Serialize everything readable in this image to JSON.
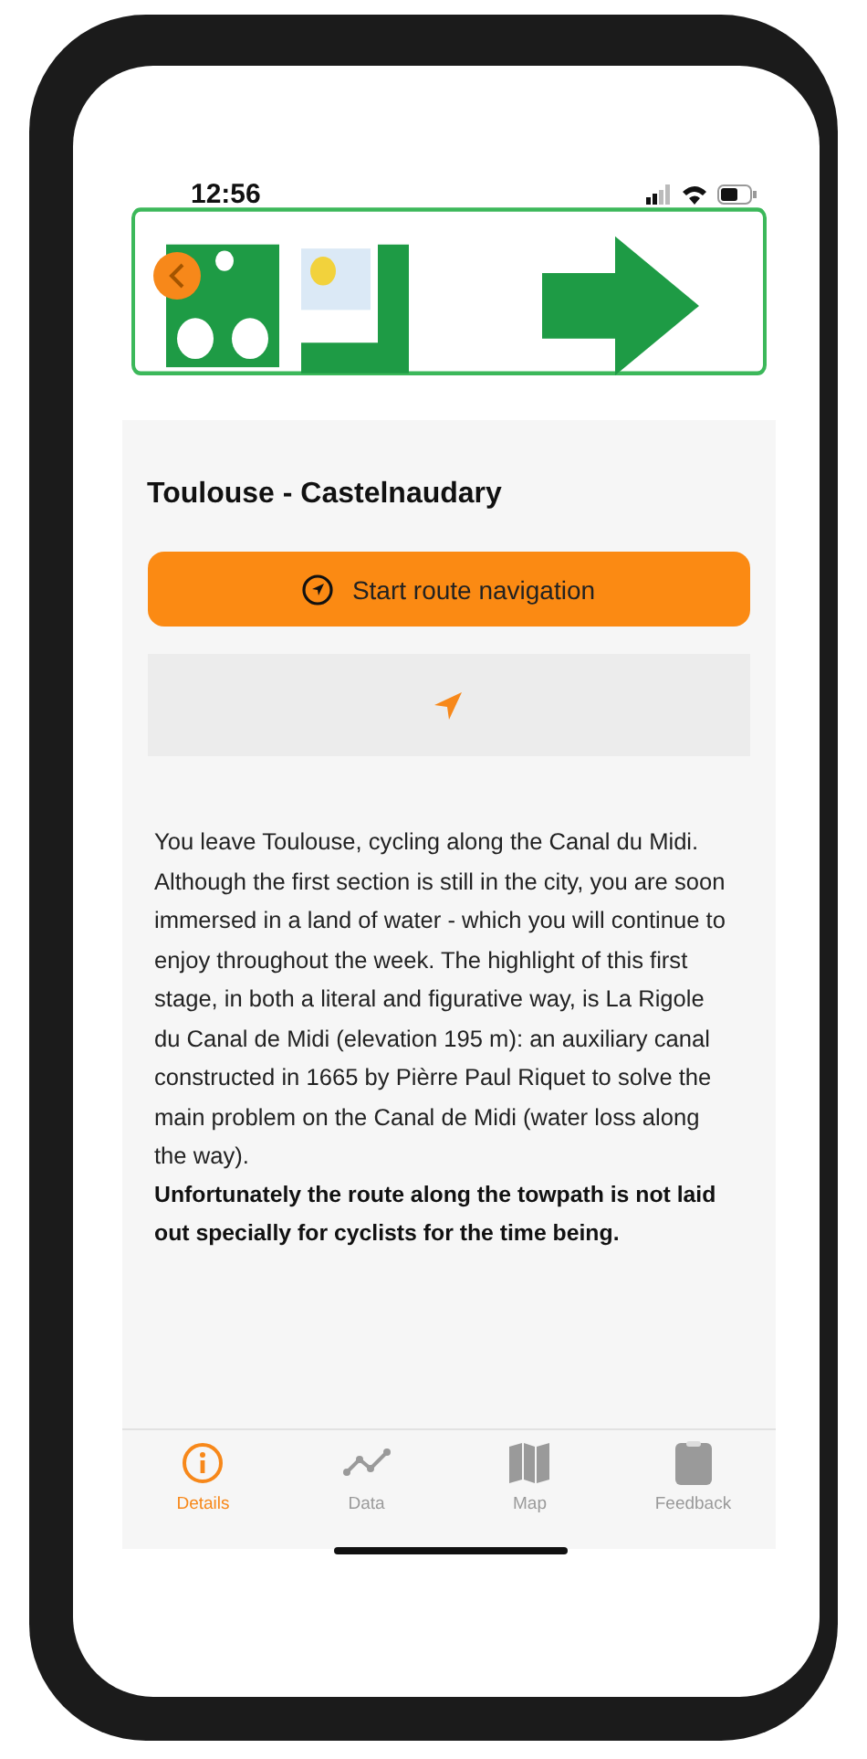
{
  "status_bar": {
    "time": "12:56"
  },
  "route": {
    "title": "Toulouse - Castelnaudary"
  },
  "start_button": {
    "label": "Start route navigation"
  },
  "description": "You leave Toulouse, cycling along the Canal du Midi. Although the first section is still in the city, you are soon immersed in a land of water - which you will continue to enjoy throughout the week. The highlight of this first stage, in both a literal and figurative way, is La Rigole du Canal de Midi (elevation 195 m): an auxiliary canal constructed in 1665 by Pièrre Paul Riquet to solve the main problem on the Canal de Midi (water loss along the way).",
  "note": "Unfortunately the route along the towpath is not laid out specially for cyclists for the time being.",
  "tabs": [
    {
      "label": "Details",
      "kind": "info",
      "selected": true
    },
    {
      "label": "Data",
      "kind": "chart",
      "selected": false
    },
    {
      "label": "Map",
      "kind": "map",
      "selected": false
    },
    {
      "label": "Feedback",
      "kind": "clipboard",
      "selected": false
    }
  ]
}
